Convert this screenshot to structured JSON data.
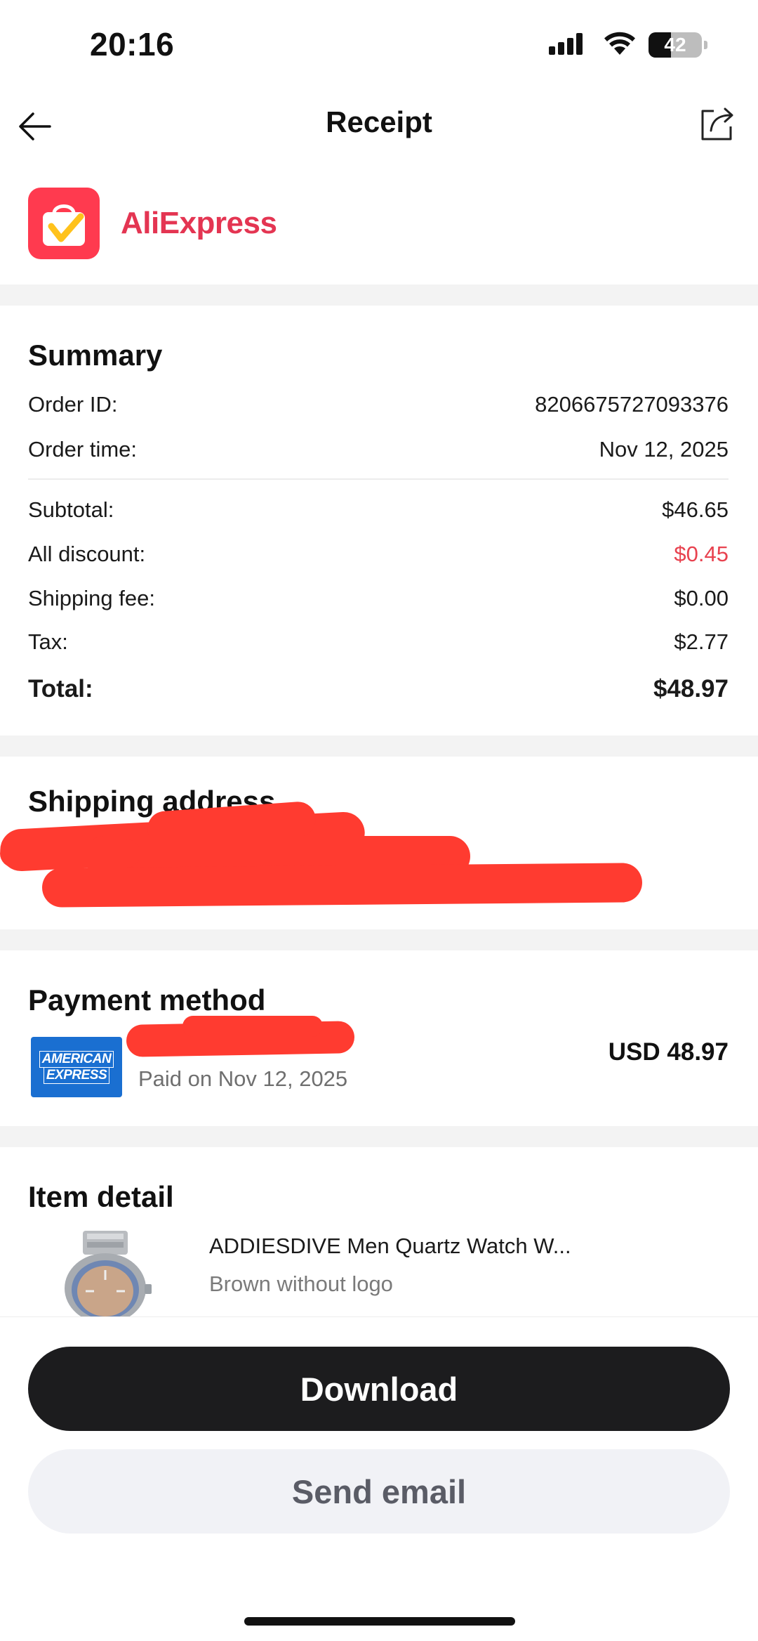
{
  "status_bar": {
    "time": "20:16",
    "battery_level": "42",
    "battery_fraction": 0.42
  },
  "header": {
    "title": "Receipt"
  },
  "brand": {
    "name": "AliExpress",
    "color": "#e43552"
  },
  "summary": {
    "title": "Summary",
    "order_id_label": "Order ID:",
    "order_id": "8206675727093376",
    "order_time_label": "Order time:",
    "order_time": "Nov 12, 2025",
    "subtotal_label": "Subtotal:",
    "subtotal": "$46.65",
    "discount_label": "All discount:",
    "discount": "$0.45",
    "shipping_label": "Shipping fee:",
    "shipping": "$0.00",
    "tax_label": "Tax:",
    "tax": "$2.77",
    "total_label": "Total:",
    "total": "$48.97"
  },
  "shipping_address": {
    "title": "Shipping address"
  },
  "payment": {
    "title": "Payment method",
    "card_brand": "AMERICAN EXPRESS",
    "card_brand_line1": "AMERICAN",
    "card_brand_line2": "EXPRESS",
    "paid_on": "Paid on Nov 12, 2025",
    "amount": "USD 48.97"
  },
  "item_detail": {
    "title": "Item detail",
    "items": [
      {
        "name": "ADDIESDIVE Men Quartz Watch W...",
        "variant": "Brown without logo"
      }
    ]
  },
  "actions": {
    "download": "Download",
    "send_email": "Send email"
  }
}
